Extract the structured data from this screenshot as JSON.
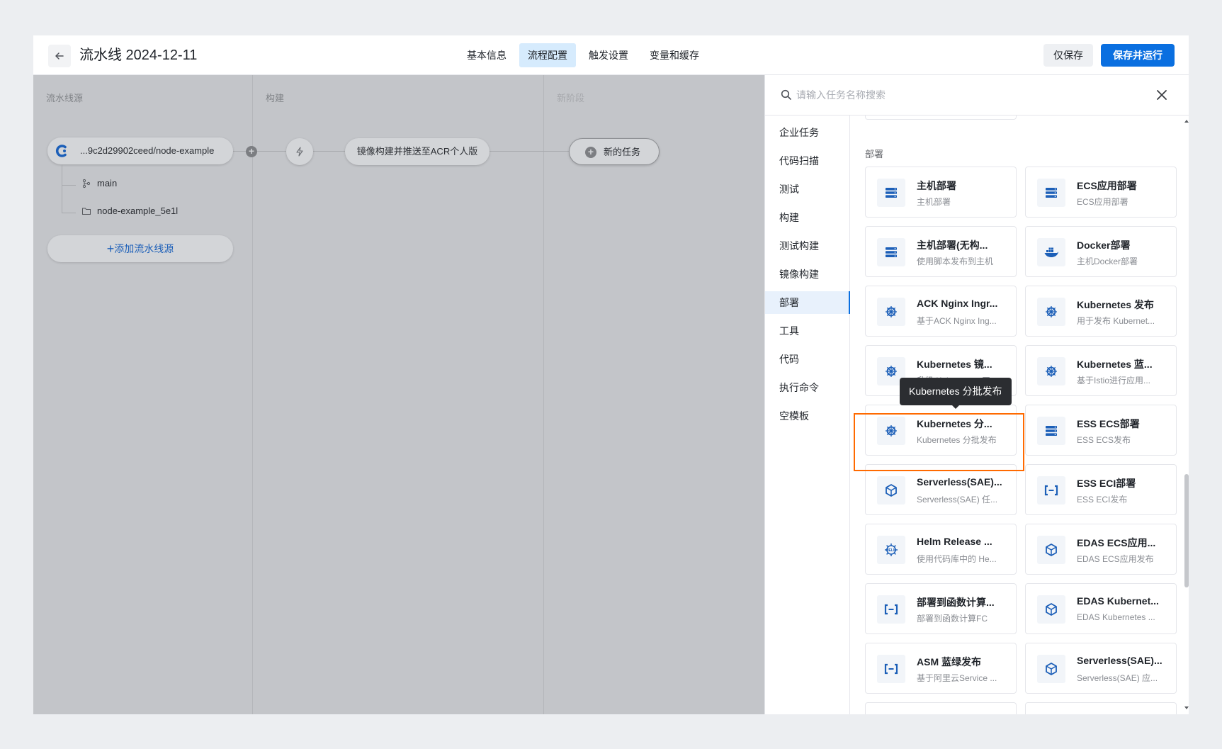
{
  "header": {
    "title": "流水线 2024-12-11",
    "tabs": [
      {
        "label": "基本信息",
        "active": false
      },
      {
        "label": "流程配置",
        "active": true
      },
      {
        "label": "触发设置",
        "active": false
      },
      {
        "label": "变量和缓存",
        "active": false
      }
    ],
    "save_label": "仅保存",
    "save_run_label": "保存并运行"
  },
  "canvas": {
    "stages": [
      {
        "title": "流水线源"
      },
      {
        "title": "构建"
      },
      {
        "title": "新阶段"
      }
    ],
    "source_name": "...9c2d29902ceed/node-example",
    "branch": "main",
    "folder": "node-example_5e1l",
    "add_source_label": "添加流水线源",
    "build_task": "镜像构建并推送至ACR个人版",
    "new_task_label": "新的任务"
  },
  "panel": {
    "search_placeholder": "请输入任务名称搜索",
    "categories": [
      {
        "label": "企业任务",
        "active": false
      },
      {
        "label": "代码扫描",
        "active": false
      },
      {
        "label": "测试",
        "active": false
      },
      {
        "label": "构建",
        "active": false
      },
      {
        "label": "测试构建",
        "active": false
      },
      {
        "label": "镜像构建",
        "active": false
      },
      {
        "label": "部署",
        "active": true
      },
      {
        "label": "工具",
        "active": false
      },
      {
        "label": "代码",
        "active": false
      },
      {
        "label": "执行命令",
        "active": false
      },
      {
        "label": "空模板",
        "active": false
      }
    ],
    "section_title": "部署",
    "cards": [
      {
        "title": "主机部署",
        "desc": "主机部署",
        "icon": "server-icon"
      },
      {
        "title": "ECS应用部署",
        "desc": "ECS应用部署",
        "icon": "server-icon"
      },
      {
        "title": "主机部署(无构...",
        "desc": "使用脚本发布到主机",
        "icon": "server-icon"
      },
      {
        "title": "Docker部署",
        "desc": "主机Docker部署",
        "icon": "docker-icon"
      },
      {
        "title": "ACK Nginx Ingr...",
        "desc": "基于ACK Nginx Ing...",
        "icon": "kubernetes-icon"
      },
      {
        "title": "Kubernetes 发布",
        "desc": "用于发布 Kubernet...",
        "icon": "kubernetes-icon"
      },
      {
        "title": "Kubernetes 镜...",
        "desc": "升级 Kubernetes 工...",
        "icon": "kubernetes-icon"
      },
      {
        "title": "Kubernetes 蓝...",
        "desc": "基于Istio进行应用...",
        "icon": "kubernetes-icon"
      },
      {
        "title": "Kubernetes 分...",
        "desc": "Kubernetes 分批发布",
        "icon": "kubernetes-icon"
      },
      {
        "title": "ESS ECS部署",
        "desc": "ESS ECS发布",
        "icon": "server-icon"
      },
      {
        "title": "Serverless(SAE)...",
        "desc": "Serverless(SAE) 任...",
        "icon": "cube-icon"
      },
      {
        "title": "ESS ECI部署",
        "desc": "ESS ECI发布",
        "icon": "bracket-icon"
      },
      {
        "title": "Helm Release ...",
        "desc": "使用代码库中的 He...",
        "icon": "helm-icon"
      },
      {
        "title": "EDAS ECS应用...",
        "desc": "EDAS ECS应用发布",
        "icon": "cube-icon"
      },
      {
        "title": "部署到函数计算...",
        "desc": "部署到函数计算FC",
        "icon": "bracket-icon"
      },
      {
        "title": "EDAS Kubernet...",
        "desc": "EDAS Kubernetes ...",
        "icon": "cube-icon"
      },
      {
        "title": "ASM 蓝绿发布",
        "desc": "基于阿里云Service ...",
        "icon": "bracket-icon"
      },
      {
        "title": "Serverless(SAE)...",
        "desc": "Serverless(SAE) 应...",
        "icon": "cube-icon"
      }
    ],
    "tooltip": "Kubernetes 分批发布"
  },
  "colors": {
    "accent": "#0a6fe0",
    "highlight": "#ff6a00",
    "overlay": "#c3c5c9"
  }
}
